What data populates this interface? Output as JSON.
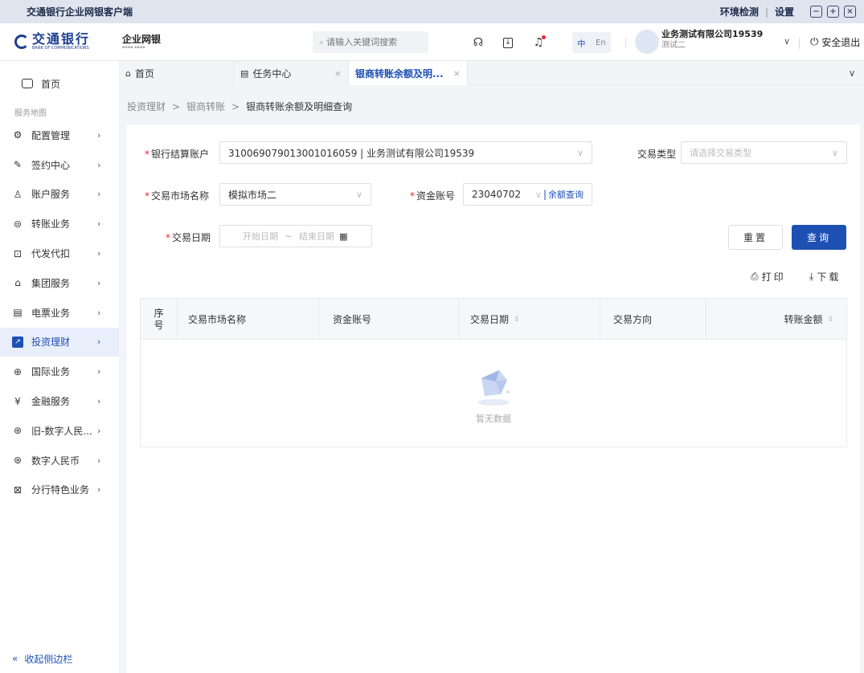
{
  "titlebar": {
    "app_title": "交通银行企业网银客户端",
    "env_check": "环境检测",
    "separator": "|",
    "settings": "设置"
  },
  "header": {
    "logo_cn": "交通银行",
    "logo_en": "BANK OF COMMUNICATIONS",
    "product": "企业网银",
    "search_placeholder": "请输入关键词搜索",
    "lang_zh": "中",
    "lang_en": "En",
    "company_name": "业务测试有限公司19539",
    "user_role": "测试二",
    "logout": "安全退出"
  },
  "sidebar": {
    "home": "首页",
    "section": "服务地图",
    "items": [
      {
        "label": "配置管理",
        "icon": "gear-icon"
      },
      {
        "label": "签约中心",
        "icon": "pen-icon"
      },
      {
        "label": "账户服务",
        "icon": "user-icon"
      },
      {
        "label": "转账业务",
        "icon": "transfer-icon"
      },
      {
        "label": "代发代扣",
        "icon": "payroll-icon"
      },
      {
        "label": "集团服务",
        "icon": "group-icon"
      },
      {
        "label": "电票业务",
        "icon": "bill-icon"
      },
      {
        "label": "投资理财",
        "icon": "invest-icon",
        "active": true
      },
      {
        "label": "国际业务",
        "icon": "globe-icon"
      },
      {
        "label": "金融服务",
        "icon": "yen-icon"
      },
      {
        "label": "旧-数字人民...",
        "icon": "ecny-icon"
      },
      {
        "label": "数字人民币",
        "icon": "ecny-icon"
      },
      {
        "label": "分行特色业务",
        "icon": "branch-icon"
      }
    ],
    "collapse": "收起侧边栏"
  },
  "tabs": [
    {
      "label": "首页"
    },
    {
      "label": "任务中心"
    },
    {
      "label": "银商转账余额及明..."
    }
  ],
  "breadcrumb": {
    "l1": "投资理财",
    "l2": "银商转账",
    "l3": "银商转账余额及明细查询",
    "sep": ">"
  },
  "form": {
    "account_label": "银行结算账户",
    "account_value": "310069079013001016059 | 业务测试有限公司19539",
    "trade_type_label": "交易类型",
    "trade_type_placeholder": "请选择交易类型",
    "market_label": "交易市场名称",
    "market_value": "模拟市场二",
    "fund_label": "资金账号",
    "fund_value": "23040702",
    "balance_link": "余额查询",
    "date_label": "交易日期",
    "start_placeholder": "开始日期",
    "range_sep": "~",
    "end_placeholder": "结束日期",
    "reset": "重置",
    "query": "查询"
  },
  "tools": {
    "print": "打印",
    "download": "下载"
  },
  "table": {
    "columns": [
      "序号",
      "交易市场名称",
      "资金账号",
      "交易日期",
      "交易方向",
      "转账金额"
    ],
    "rows": [],
    "empty_text": "暂无数据"
  },
  "colors": {
    "accent": "#1e50b4",
    "required": "#e23"
  }
}
